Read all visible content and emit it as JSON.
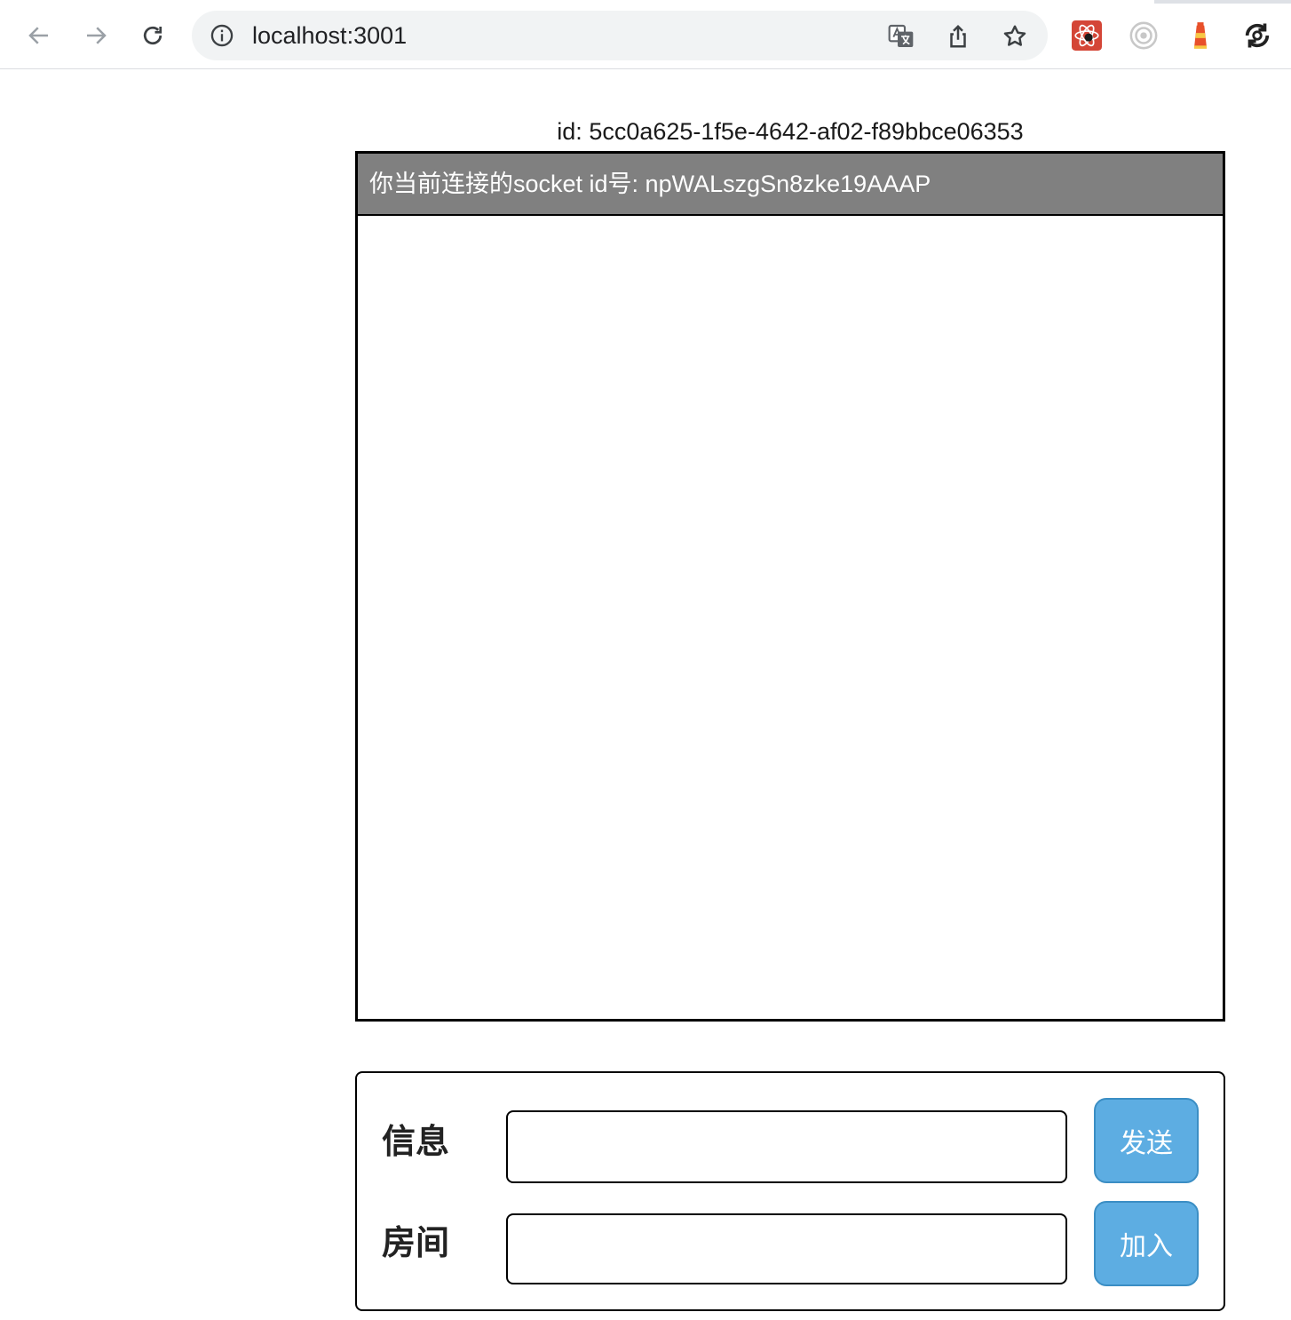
{
  "browser": {
    "url": "localhost:3001",
    "icons": {
      "back": "back-arrow-icon",
      "forward": "forward-arrow-icon",
      "reload": "reload-icon",
      "site_info": "info-icon",
      "translate": "translate-icon",
      "share": "share-icon",
      "bookmark": "star-icon",
      "extensions": [
        "react-devtools-icon",
        "record-icon",
        "lighthouse-icon",
        "sync-icon"
      ]
    }
  },
  "page": {
    "id_text": "id: 5cc0a625-1f5e-4642-af02-f89bbce06353",
    "chat": {
      "header_text": "你当前连接的socket id号: npWALszgSn8zke19AAAP",
      "messages": []
    },
    "form": {
      "message_label": "信息",
      "message_value": "",
      "send_button": "发送",
      "room_label": "房间",
      "room_value": "",
      "join_button": "加入"
    }
  },
  "colors": {
    "chat_header_bg": "#808080",
    "button_bg": "#5dade2",
    "omnibox_bg": "#f1f3f4"
  }
}
